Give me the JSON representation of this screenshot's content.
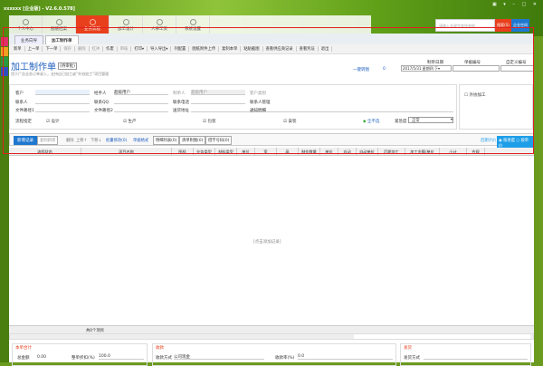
{
  "app": {
    "title": "xxxxxx [企业版] - V2.6.0.578]",
    "window_controls": "▣ ▾ – □ ✕"
  },
  "nav": [
    {
      "label": "个人中心"
    },
    {
      "label": "图纸档案"
    },
    {
      "label": "业务流程",
      "active": true
    },
    {
      "label": "加工设计"
    },
    {
      "label": "人事工资"
    },
    {
      "label": "系统设置"
    }
  ],
  "search": {
    "placeholder": "请输入关键字查找单据",
    "button": "搜索(S)",
    "space": "企业空间"
  },
  "tabs": [
    {
      "label": "业务向导"
    },
    {
      "label": "加工制作单",
      "active": true
    }
  ],
  "toolbar": [
    {
      "label": "新单"
    },
    {
      "label": "上一单"
    },
    {
      "label": "下一单"
    },
    {
      "label": "保存",
      "disabled": true
    },
    {
      "label": "删除",
      "disabled": true
    },
    {
      "label": "红冲",
      "disabled": true
    },
    {
      "label": "作废"
    },
    {
      "label": "审核",
      "disabled": true
    },
    {
      "label": "打印▾"
    },
    {
      "label": "导入导出▾"
    },
    {
      "label": "列配置"
    },
    {
      "label": "图纸附件上传"
    },
    {
      "label": "复制本单"
    },
    {
      "label": "粘贴截图"
    },
    {
      "label": "查看供应商记录"
    },
    {
      "label": "查看凭证"
    },
    {
      "label": "退出"
    }
  ],
  "page": {
    "title": "加工制作单",
    "status": "(待审批)",
    "subtitle": "用于广告业务订单录入，支持自已加工或“外协加工”项目管理",
    "quick": "一键转图",
    "print_count": "0"
  },
  "header_fields": {
    "date_label": "制单日期",
    "date_value": "2017/5/31 星期四 下▾",
    "no_label": "单据编号",
    "no_value": "",
    "custom_label": "自定义编号",
    "custom_value": ""
  },
  "form": {
    "customer": "客户",
    "handler": "经手人",
    "handler_value": "超级用户",
    "creator": "制单人",
    "creator_value": "超级用户",
    "cust_type": "客户类别",
    "contact": "联系人",
    "qq": "联系QQ",
    "phone": "联系电话",
    "contact_mgr": "联系人管理",
    "path1": "文件路径1",
    "path2": "文件路径2",
    "address": "送货地址",
    "notice": "通知明细",
    "flow": "流程指定",
    "flows": [
      "设计",
      "生产",
      "包装",
      "安装"
    ],
    "none": "全不选",
    "urgency_label": "紧急度",
    "urgency": "正常",
    "outsource": "外协加工"
  },
  "grid": {
    "add": "新增记录",
    "copy": "复制新增",
    "delete": "删除",
    "up": "上移↑",
    "down": "下移↓",
    "batch": "批量修改(0)",
    "format": "单据格式",
    "tabs": [
      "明细列表(0)",
      "清单附图(0)",
      "借字号码(0)"
    ],
    "later": "后期计价",
    "r1": "按进度",
    "r2": "按单价",
    "columns": [
      "流程状态",
      "项目名称",
      "图样",
      "业务类型",
      "材料类型",
      "单位",
      "宽",
      "高",
      "制作数量",
      "单价",
      "自动",
      "自动单价",
      "后期加工",
      "加工金额/单价",
      "小计",
      "合规"
    ],
    "empty": "[点击添加记录]",
    "total": "共0个项目"
  },
  "summary": {
    "title": "本单合计",
    "amount_label": "总金额",
    "amount": "0.00",
    "discount_label": "整单折扣(%)",
    "discount": "100.0"
  },
  "receipt": {
    "title": "收款",
    "method_label": "收款方式",
    "method": "公司现金",
    "rate_label": "收款率(%)",
    "rate": "0.0"
  },
  "delivery": {
    "title": "发货",
    "method_label": "发货方式",
    "method": ""
  }
}
